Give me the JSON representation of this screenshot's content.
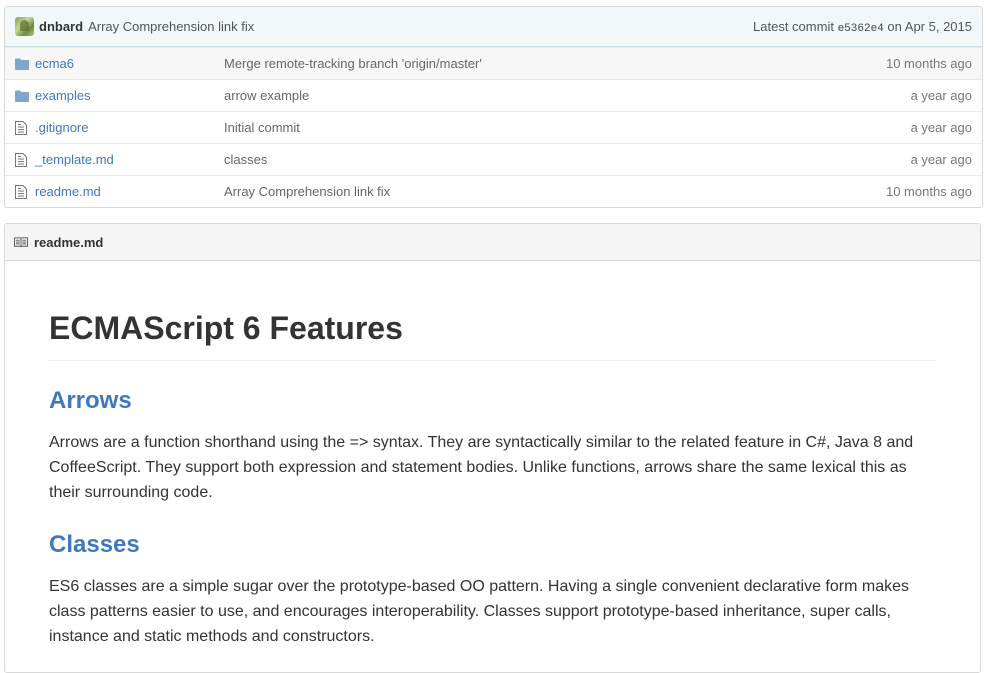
{
  "commit": {
    "author": "dnbard",
    "message": "Array Comprehension link fix",
    "latest_label": "Latest commit",
    "sha": "e5362e4",
    "date": "on Apr 5, 2015"
  },
  "files": [
    {
      "type": "folder",
      "name": "ecma6",
      "message": "Merge remote-tracking branch 'origin/master'",
      "age": "10 months ago",
      "icon": "folder-icon"
    },
    {
      "type": "folder",
      "name": "examples",
      "message": "arrow example",
      "age": "a year ago",
      "icon": "folder-icon"
    },
    {
      "type": "file",
      "name": ".gitignore",
      "message": "Initial commit",
      "age": "a year ago",
      "icon": "file-text-icon"
    },
    {
      "type": "file",
      "name": "_template.md",
      "message": "classes",
      "age": "a year ago",
      "icon": "file-text-icon"
    },
    {
      "type": "file",
      "name": "readme.md",
      "message": "Array Comprehension link fix",
      "age": "10 months ago",
      "icon": "file-text-icon"
    }
  ],
  "readme": {
    "header": "readme.md",
    "title": "ECMAScript 6 Features",
    "sections": [
      {
        "heading": "Arrows",
        "text": "Arrows are a function shorthand using the => syntax. They are syntactically similar to the related feature in C#, Java 8 and CoffeeScript. They support both expression and statement bodies. Unlike functions, arrows share the same lexical this as their surrounding code."
      },
      {
        "heading": "Classes",
        "text": "ES6 classes are a simple sugar over the prototype-based OO pattern. Having a single convenient declarative form makes class patterns easier to use, and encourages interoperability. Classes support prototype-based inheritance, super calls, instance and static methods and constructors."
      }
    ]
  },
  "colors": {
    "link": "#4078c0",
    "folder_icon": "#80a6cd",
    "commit_bar_bg": "#f2f8fa"
  }
}
